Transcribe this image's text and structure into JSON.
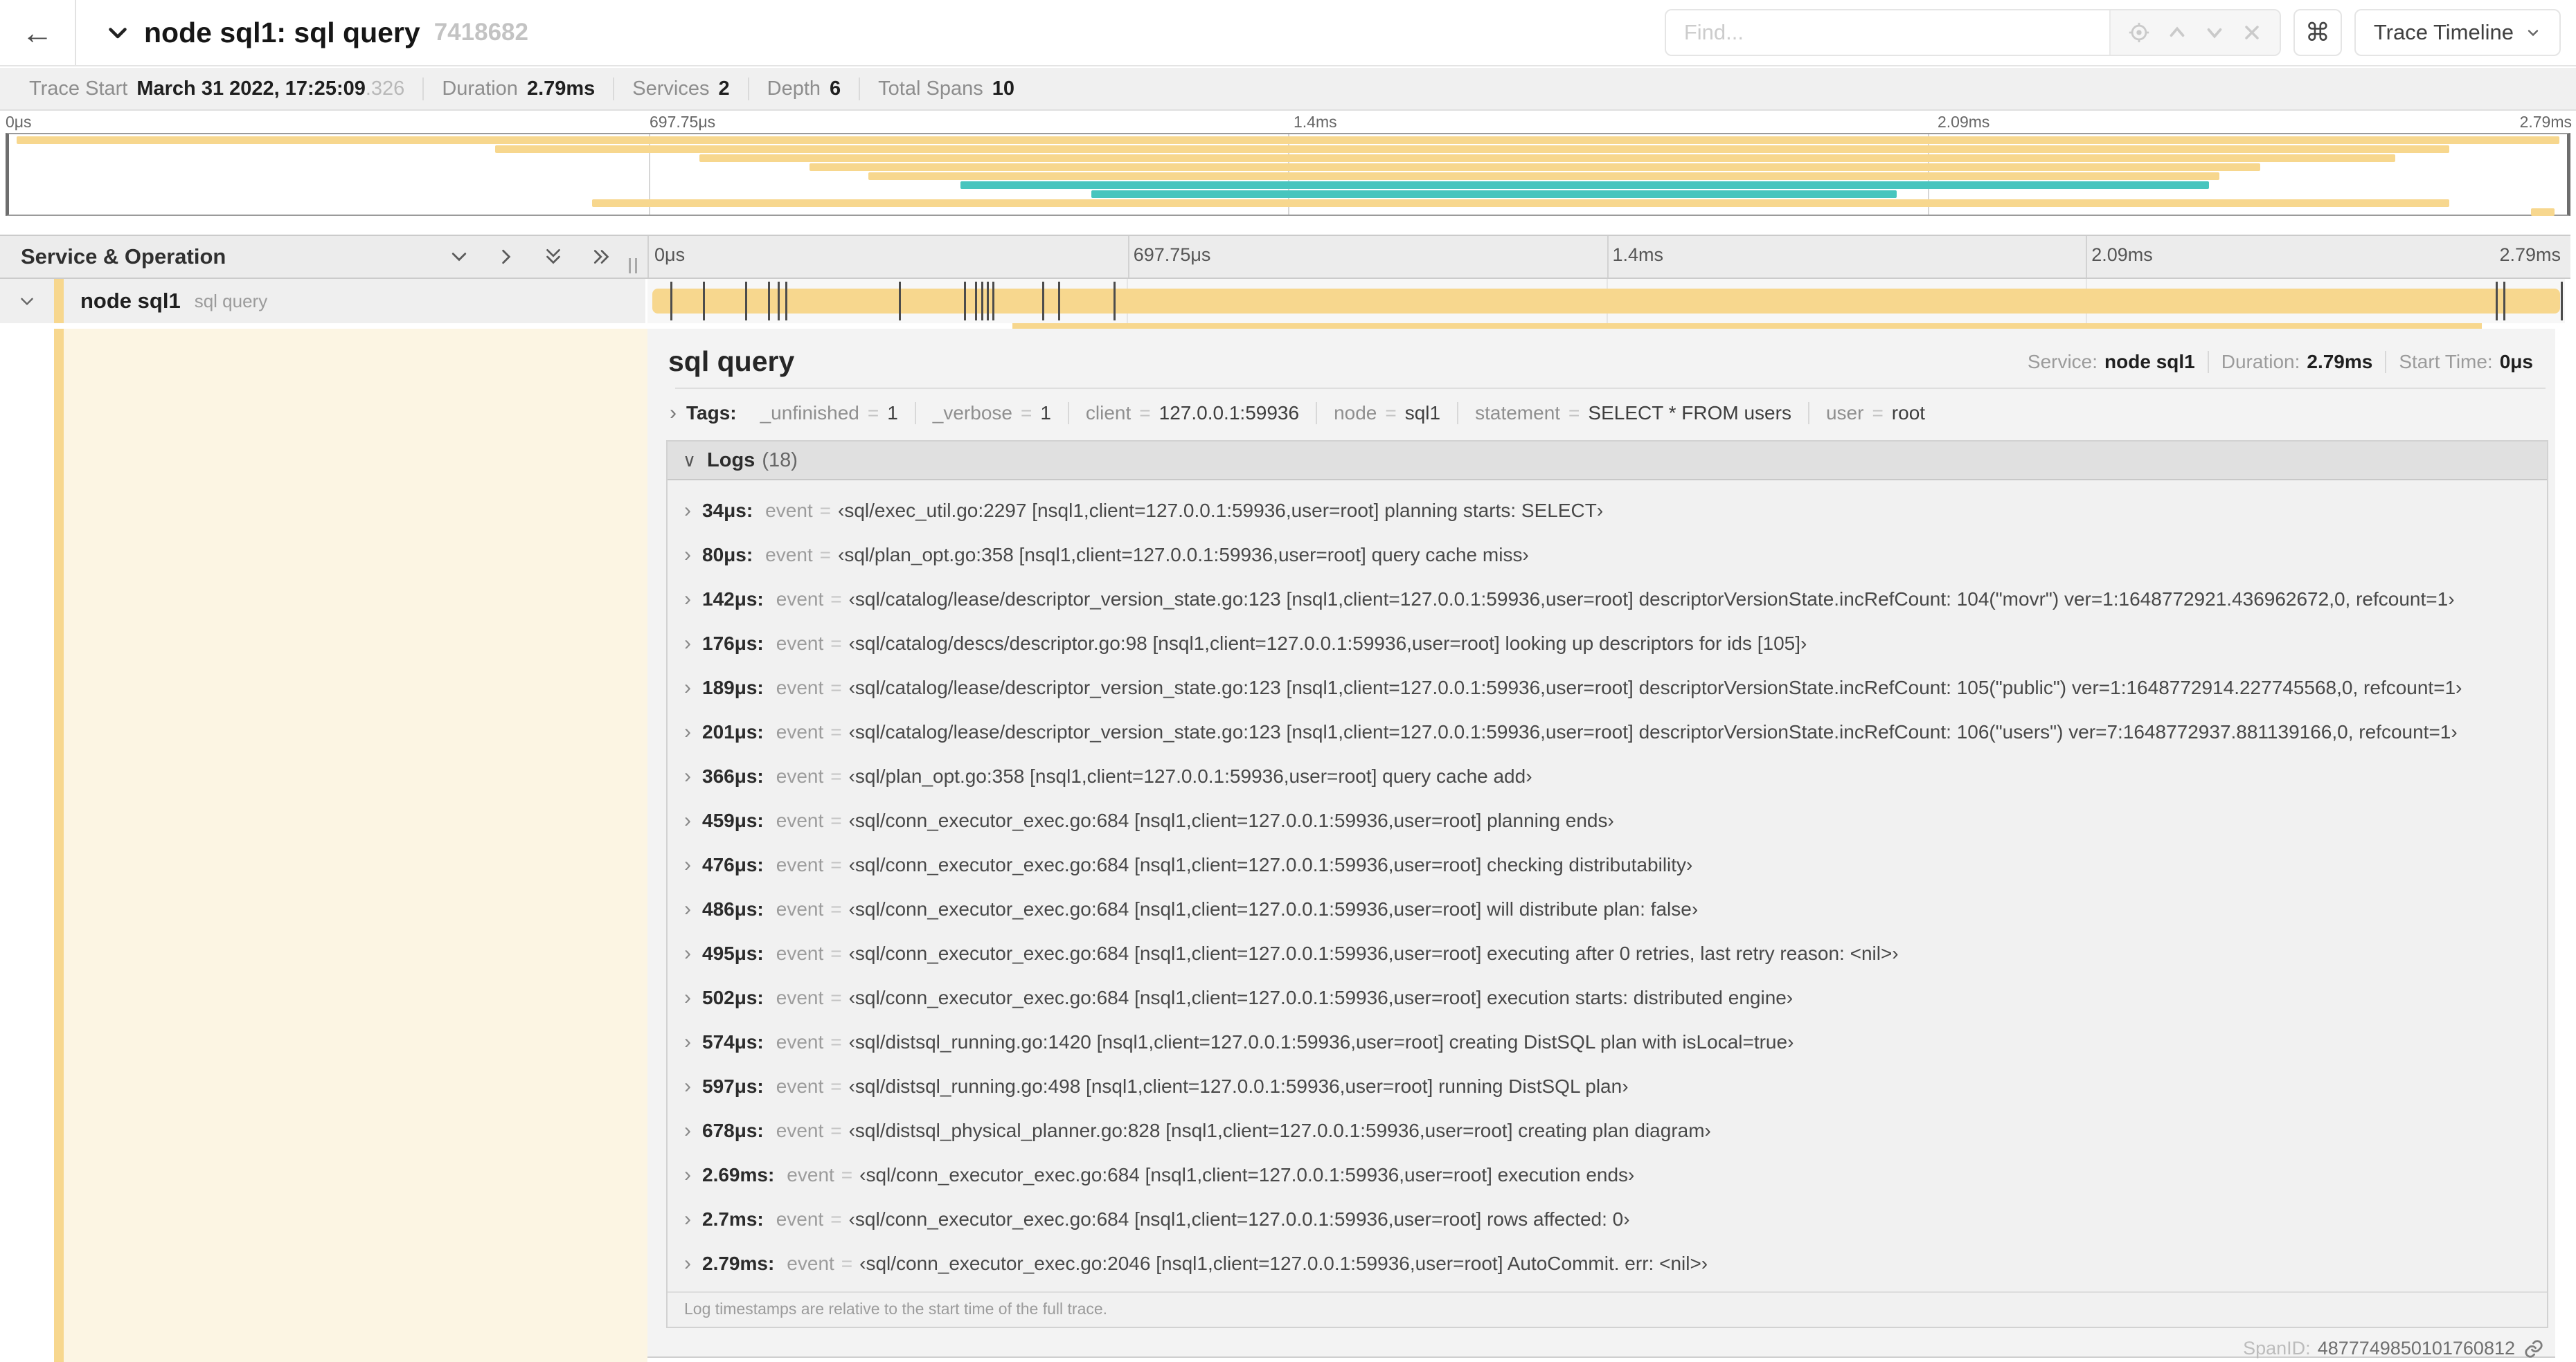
{
  "topnav": {
    "back_glyph": "←",
    "title": "node sql1: sql query",
    "trace_id": "7418682",
    "find_placeholder": "Find...",
    "cmd_glyph": "⌘",
    "view_selector_label": "Trace Timeline"
  },
  "summary": {
    "items": [
      {
        "label": "Trace Start",
        "value": "March 31 2022, 17:25:09",
        "suffix": ".326"
      },
      {
        "label": "Duration",
        "value": "2.79ms",
        "suffix": ""
      },
      {
        "label": "Services",
        "value": "2",
        "suffix": ""
      },
      {
        "label": "Depth",
        "value": "6",
        "suffix": ""
      },
      {
        "label": "Total Spans",
        "value": "10",
        "suffix": ""
      }
    ]
  },
  "timeline": {
    "ruler": [
      {
        "label": "0μs",
        "pct": 0
      },
      {
        "label": "697.75μs",
        "pct": 25
      },
      {
        "label": "1.4ms",
        "pct": 50
      },
      {
        "label": "2.09ms",
        "pct": 75
      },
      {
        "label": "2.79ms",
        "pct": 100
      }
    ],
    "minimap_rows": [
      {
        "color": "tan",
        "start": 0.3,
        "end": 99.7
      },
      {
        "color": "tan",
        "start": 19.0,
        "end": 95.4
      },
      {
        "color": "tan",
        "start": 27.0,
        "end": 93.3
      },
      {
        "color": "tan",
        "start": 31.3,
        "end": 88.0
      },
      {
        "color": "tan",
        "start": 33.6,
        "end": 86.4
      },
      {
        "color": "teal",
        "start": 37.2,
        "end": 86.0
      },
      {
        "color": "teal",
        "start": 42.3,
        "end": 73.8
      },
      {
        "color": "tan",
        "start": 22.8,
        "end": 95.4
      },
      {
        "color": "tan",
        "start": 98.6,
        "end": 99.5
      }
    ],
    "log_marks_pct": [
      1.2,
      2.9,
      5.1,
      6.3,
      6.8,
      7.2,
      13.1,
      16.5,
      17.1,
      17.4,
      17.7,
      18.0,
      20.6,
      21.4,
      24.3,
      96.4,
      96.8,
      99.8
    ]
  },
  "grid": {
    "title": "Service & Operation"
  },
  "row": {
    "service": "node sql1",
    "operation": "sql query"
  },
  "detail": {
    "title": "sql query",
    "meta": [
      {
        "label": "Service:",
        "value": "node sql1"
      },
      {
        "label": "Duration:",
        "value": "2.79ms"
      },
      {
        "label": "Start Time:",
        "value": "0μs"
      }
    ],
    "tags_label": "Tags:",
    "tags": [
      {
        "key": "_unfinished",
        "value": "1"
      },
      {
        "key": "_verbose",
        "value": "1"
      },
      {
        "key": "client",
        "value": "127.0.0.1:59936"
      },
      {
        "key": "node",
        "value": "sql1"
      },
      {
        "key": "statement",
        "value": "SELECT * FROM users"
      },
      {
        "key": "user",
        "value": "root"
      }
    ],
    "logs_label": "Logs",
    "logs_count": "(18)",
    "logs": [
      {
        "time": "34μs:",
        "key": "event",
        "value": "‹sql/exec_util.go:2297 [nsql1,client=127.0.0.1:59936,user=root] planning starts: SELECT›"
      },
      {
        "time": "80μs:",
        "key": "event",
        "value": "‹sql/plan_opt.go:358 [nsql1,client=127.0.0.1:59936,user=root] query cache miss›"
      },
      {
        "time": "142μs:",
        "key": "event",
        "value": "‹sql/catalog/lease/descriptor_version_state.go:123 [nsql1,client=127.0.0.1:59936,user=root] descriptorVersionState.incRefCount: 104(\"movr\") ver=1:1648772921.436962672,0, refcount=1›"
      },
      {
        "time": "176μs:",
        "key": "event",
        "value": "‹sql/catalog/descs/descriptor.go:98 [nsql1,client=127.0.0.1:59936,user=root] looking up descriptors for ids [105]›"
      },
      {
        "time": "189μs:",
        "key": "event",
        "value": "‹sql/catalog/lease/descriptor_version_state.go:123 [nsql1,client=127.0.0.1:59936,user=root] descriptorVersionState.incRefCount: 105(\"public\") ver=1:1648772914.227745568,0, refcount=1›"
      },
      {
        "time": "201μs:",
        "key": "event",
        "value": "‹sql/catalog/lease/descriptor_version_state.go:123 [nsql1,client=127.0.0.1:59936,user=root] descriptorVersionState.incRefCount: 106(\"users\") ver=7:1648772937.881139166,0, refcount=1›"
      },
      {
        "time": "366μs:",
        "key": "event",
        "value": "‹sql/plan_opt.go:358 [nsql1,client=127.0.0.1:59936,user=root] query cache add›"
      },
      {
        "time": "459μs:",
        "key": "event",
        "value": "‹sql/conn_executor_exec.go:684 [nsql1,client=127.0.0.1:59936,user=root] planning ends›"
      },
      {
        "time": "476μs:",
        "key": "event",
        "value": "‹sql/conn_executor_exec.go:684 [nsql1,client=127.0.0.1:59936,user=root] checking distributability›"
      },
      {
        "time": "486μs:",
        "key": "event",
        "value": "‹sql/conn_executor_exec.go:684 [nsql1,client=127.0.0.1:59936,user=root] will distribute plan: false›"
      },
      {
        "time": "495μs:",
        "key": "event",
        "value": "‹sql/conn_executor_exec.go:684 [nsql1,client=127.0.0.1:59936,user=root] executing after 0 retries, last retry reason: <nil>›"
      },
      {
        "time": "502μs:",
        "key": "event",
        "value": "‹sql/conn_executor_exec.go:684 [nsql1,client=127.0.0.1:59936,user=root] execution starts: distributed engine›"
      },
      {
        "time": "574μs:",
        "key": "event",
        "value": "‹sql/distsql_running.go:1420 [nsql1,client=127.0.0.1:59936,user=root] creating DistSQL plan with isLocal=true›"
      },
      {
        "time": "597μs:",
        "key": "event",
        "value": "‹sql/distsql_running.go:498 [nsql1,client=127.0.0.1:59936,user=root] running DistSQL plan›"
      },
      {
        "time": "678μs:",
        "key": "event",
        "value": "‹sql/distsql_physical_planner.go:828 [nsql1,client=127.0.0.1:59936,user=root] creating plan diagram›"
      },
      {
        "time": "2.69ms:",
        "key": "event",
        "value": "‹sql/conn_executor_exec.go:684 [nsql1,client=127.0.0.1:59936,user=root] execution ends›"
      },
      {
        "time": "2.7ms:",
        "key": "event",
        "value": "‹sql/conn_executor_exec.go:684 [nsql1,client=127.0.0.1:59936,user=root] rows affected: 0›"
      },
      {
        "time": "2.79ms:",
        "key": "event",
        "value": "‹sql/conn_executor_exec.go:2046 [nsql1,client=127.0.0.1:59936,user=root] AutoCommit. err: <nil>›"
      }
    ],
    "note": "Log timestamps are relative to the start time of the full trace.",
    "span_id_label": "SpanID:",
    "span_id": "4877749850101760812"
  },
  "colors": {
    "span_tan": "#F7D78E",
    "span_teal": "#48C5BE",
    "detail_cream": "#FCF5E3"
  }
}
